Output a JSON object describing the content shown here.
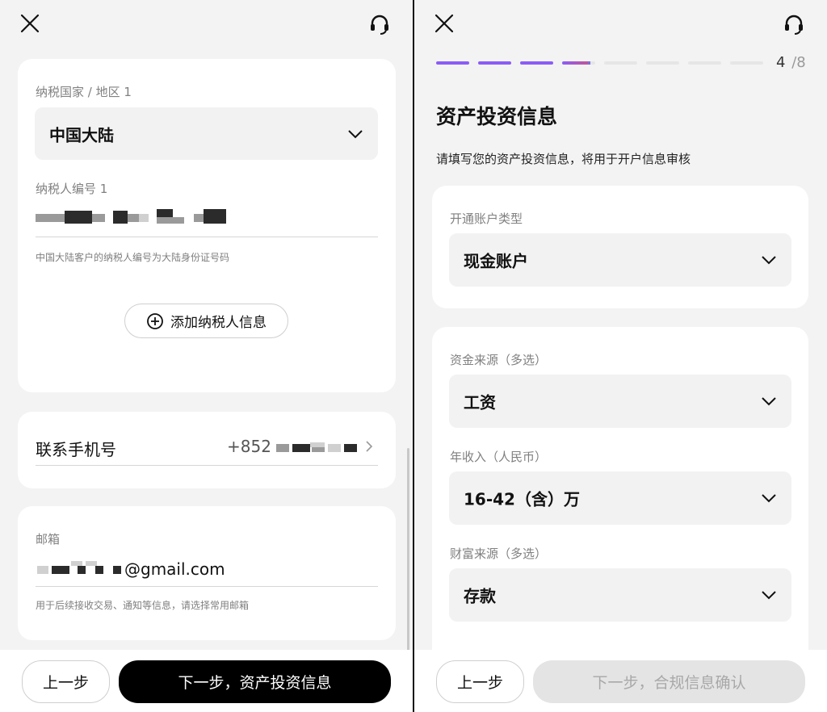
{
  "left": {
    "tax_card": {
      "country_label": "纳税国家 / 地区 1",
      "country_value": "中国大陆",
      "taxpayer_id_label": "纳税人编号 1",
      "taxpayer_hint": "中国大陆客户的纳税人编号为大陆身份证号码",
      "add_taxpayer_label": "添加纳税人信息"
    },
    "phone_card": {
      "label": "联系手机号",
      "country_code": "+852"
    },
    "email_card": {
      "label": "邮箱",
      "email_suffix": "@gmail.com",
      "hint": "用于后续接收交易、通知等信息，请选择常用邮箱"
    },
    "footer": {
      "prev_label": "上一步",
      "next_label": "下一步，资产投资信息"
    }
  },
  "right": {
    "progress": {
      "current": "4",
      "total": "/8",
      "step": 4,
      "step_count": 8,
      "current_step_fill": 0.85,
      "active_color": "#8b5cf6",
      "inactive_color": "#e6e6e6"
    },
    "title": "资产投资信息",
    "subtitle": "请填写您的资产投资信息，将用于开户信息审核",
    "account_card": {
      "label": "开通账户类型",
      "value": "现金账户"
    },
    "investment_card": {
      "fund_source_label": "资金来源（多选）",
      "fund_source_value": "工资",
      "income_label": "年收入（人民币）",
      "income_value": "16-42（含）万",
      "wealth_source_label": "财富来源（多选）",
      "wealth_source_value": "存款"
    },
    "footer": {
      "prev_label": "上一步",
      "next_label": "下一步，合规信息确认"
    }
  },
  "icons": {
    "close": "close-icon",
    "support": "headset-icon",
    "chevron": "chevron-down-icon",
    "add": "plus-circle-icon",
    "arrow": "chevron-right-icon"
  }
}
